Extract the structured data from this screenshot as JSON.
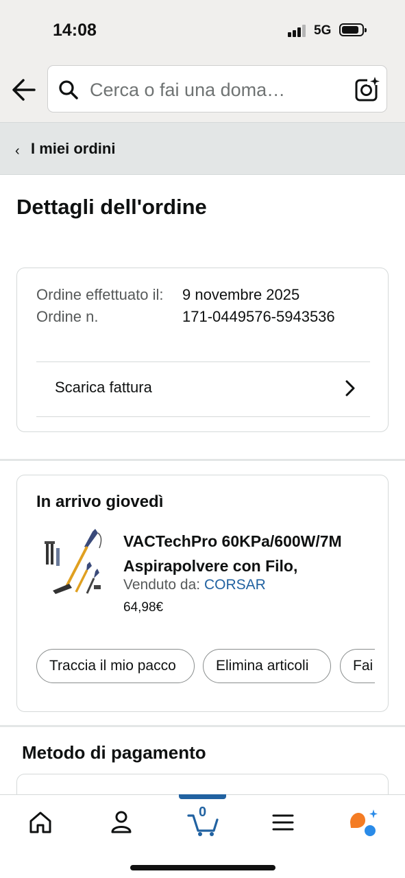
{
  "status_bar": {
    "time": "14:08",
    "network": "5G"
  },
  "search": {
    "placeholder": "Cerca o fai una doma…"
  },
  "breadcrumb": {
    "label": "I miei ordini"
  },
  "page": {
    "title": "Dettagli dell'ordine"
  },
  "order": {
    "placed_label": "Ordine effettuato il:",
    "number_label": "Ordine n.",
    "placed_value": "9 novembre 2025",
    "number_value": "171-0449576-5943536",
    "invoice_label": "Scarica fattura"
  },
  "shipment": {
    "status": "In arrivo giovedì",
    "product_name": "VACTechPro 60KPa/600W/7M Aspirapolvere con Filo,",
    "seller_label": "Venduto da:",
    "seller_name": "CORSAR",
    "price": "64,98€",
    "actions": [
      "Traccia il mio pacco",
      "Elimina articoli",
      "Fai"
    ]
  },
  "payment": {
    "section_title": "Metodo di pagamento"
  },
  "bottom_nav": {
    "cart_count": "0",
    "items": [
      "home-icon",
      "account-icon",
      "cart-icon",
      "menu-icon",
      "rufus-icon"
    ]
  },
  "colors": {
    "link": "#2162a1",
    "header_bg": "#f0efed",
    "breadcrumb_bg": "#e3e6e6"
  }
}
